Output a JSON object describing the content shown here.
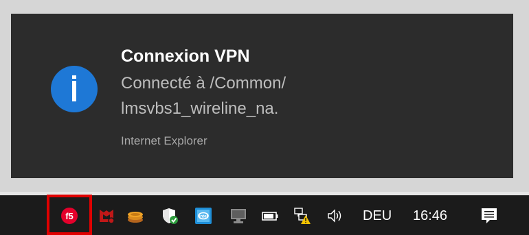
{
  "notification": {
    "title": "Connexion VPN",
    "message_line1": "Connecté à /Common/",
    "message_line2": "lmsvbs1_wireline_na.",
    "source": "Internet Explorer",
    "icon": "info-icon"
  },
  "taskbar": {
    "tray_icons": [
      {
        "name": "f5-vpn-icon",
        "highlighted": true,
        "highlight_color": "#e00000"
      },
      {
        "name": "mcafee-icon"
      },
      {
        "name": "coin-stack-icon"
      },
      {
        "name": "windows-security-icon"
      },
      {
        "name": "intel-graphics-icon"
      },
      {
        "name": "monitor-icon"
      },
      {
        "name": "battery-icon"
      },
      {
        "name": "network-warning-icon"
      },
      {
        "name": "volume-icon"
      }
    ],
    "language": "DEU",
    "time": "16:46",
    "notifications_icon": "action-center-icon"
  },
  "colors": {
    "toast_background": "#2c2c2c",
    "info_icon_blue": "#1e78d6",
    "taskbar_background": "#1b1b1b"
  }
}
